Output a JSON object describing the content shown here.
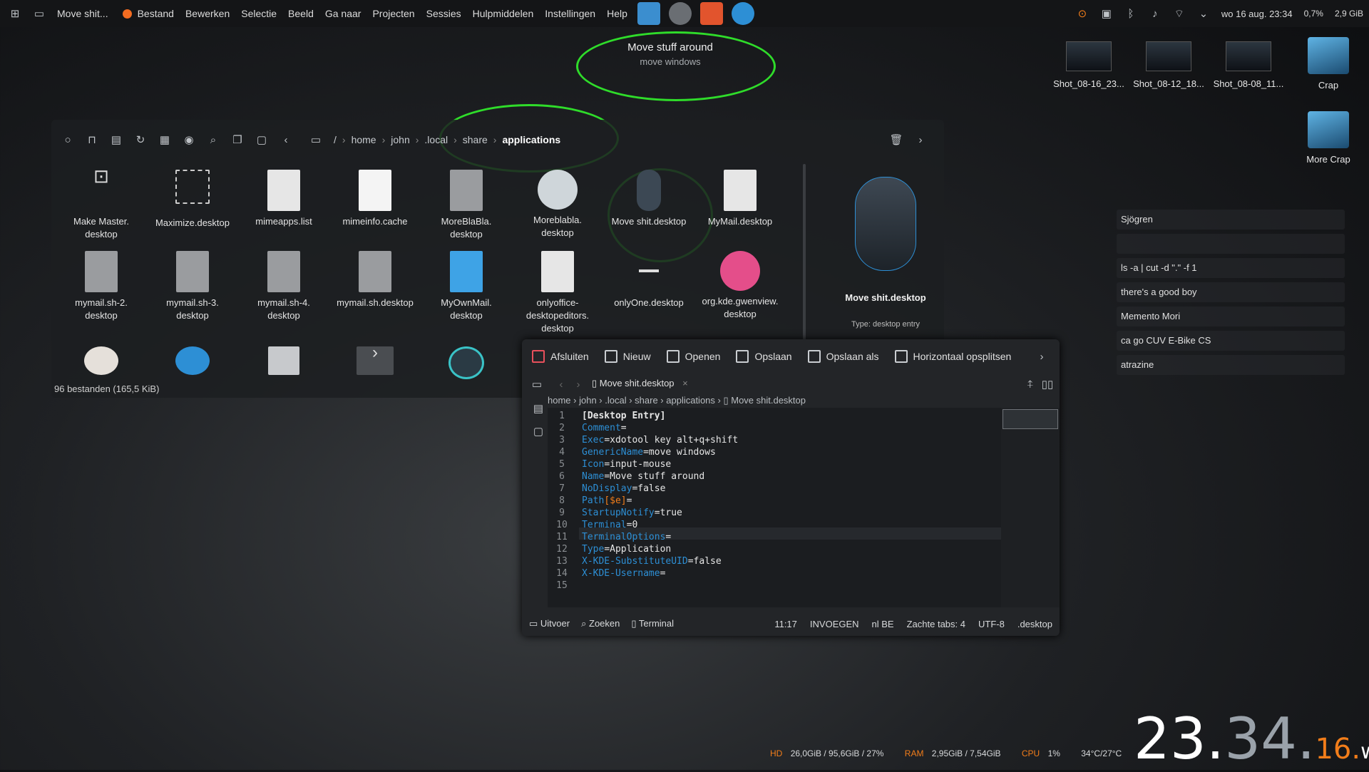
{
  "panel": {
    "app_title": "Move shit...",
    "menu": [
      "Bestand",
      "Bewerken",
      "Selectie",
      "Beeld",
      "Ga naar",
      "Projecten",
      "Sessies",
      "Hulpmiddelen",
      "Instellingen",
      "Help"
    ],
    "datetime": "wo 16 aug. 23:34",
    "cpu_pct": "0,7%",
    "ram": "2,9 GiB"
  },
  "tooltip": {
    "title": "Move stuff around",
    "subtitle": "move windows"
  },
  "desktop_icons": [
    "Shot_08-16_23...",
    "Shot_08-12_18...",
    "Shot_08-08_11...",
    "Crap",
    "More Crap"
  ],
  "dolphin": {
    "breadcrumb": [
      "/",
      "home",
      "john",
      ".local",
      "share",
      "applications"
    ],
    "files": [
      [
        "Make Master.",
        "desktop"
      ],
      [
        "Maximize.desktop",
        ""
      ],
      [
        "mimeapps.list",
        ""
      ],
      [
        "mimeinfo.cache",
        ""
      ],
      [
        "MoreBlaBla.",
        "desktop"
      ],
      [
        "Moreblabla.",
        "desktop"
      ],
      [
        "Move shit.desktop",
        ""
      ],
      [
        "MyMail.desktop",
        ""
      ],
      [
        "mymail.sh-2.",
        "desktop"
      ],
      [
        "mymail.sh-3.",
        "desktop"
      ],
      [
        "mymail.sh-4.",
        "desktop"
      ],
      [
        "mymail.sh.desktop",
        ""
      ],
      [
        "MyOwnMail.",
        "desktop"
      ],
      [
        "onlyoffice-",
        "desktopeditors.",
        "desktop"
      ],
      [
        "onlyOne.desktop",
        ""
      ],
      [
        "org.kde.gwenview.",
        "desktop"
      ]
    ],
    "status": "96 bestanden (165,5 KiB)",
    "preview_name": "Move shit.desktop",
    "preview_type_label": "Type:",
    "preview_type_value": "desktop entry"
  },
  "kate": {
    "toolbar": [
      "Afsluiten",
      "Nieuw",
      "Openen",
      "Opslaan",
      "Opslaan als",
      "Horizontaal opsplitsen"
    ],
    "tab": "Move shit.desktop",
    "breadcrumb": [
      "home",
      "john",
      ".local",
      "share",
      "applications",
      "Move shit.desktop"
    ],
    "lines": [
      {
        "n": "1",
        "k": "[Desktop Entry]",
        "v": ""
      },
      {
        "n": "2",
        "k": "Comment",
        "v": "="
      },
      {
        "n": "3",
        "k": "Exec",
        "v": "=xdotool key alt+q+shift"
      },
      {
        "n": "4",
        "k": "GenericName",
        "v": "=move windows"
      },
      {
        "n": "5",
        "k": "Icon",
        "v": "=input-mouse"
      },
      {
        "n": "6",
        "k": "Name",
        "v": "=Move stuff around"
      },
      {
        "n": "7",
        "k": "NoDisplay",
        "v": "=false"
      },
      {
        "n": "8",
        "k": "Path",
        "v": "="
      },
      {
        "n": "9",
        "k": "StartupNotify",
        "v": "=true"
      },
      {
        "n": "10",
        "k": "Terminal",
        "v": "=0"
      },
      {
        "n": "11",
        "k": "TerminalOptions",
        "v": "="
      },
      {
        "n": "12",
        "k": "Type",
        "v": "=Application"
      },
      {
        "n": "13",
        "k": "X-KDE-SubstituteUID",
        "v": "=false"
      },
      {
        "n": "14",
        "k": "X-KDE-Username",
        "v": "="
      },
      {
        "n": "15",
        "k": "",
        "v": ""
      }
    ],
    "path_suffix": "[$e]",
    "status": {
      "output": "Uitvoer",
      "search": "Zoeken",
      "terminal": "Terminal",
      "pos": "11:17",
      "mode": "INVOEGEN",
      "lang": "nl BE",
      "tabs": "Zachte tabs: 4",
      "enc": "UTF-8",
      "type": ".desktop"
    }
  },
  "clipboard": [
    "Sjögren",
    "",
    "ls -a | cut -d \".\" -f 1",
    "there's a good boy",
    "Memento Mori",
    "ca go CUV E-Bike CS",
    "atrazine"
  ],
  "stats": {
    "hd_label": "HD",
    "hd_value": "26,0GiB / 95,6GiB / 27%",
    "ram_label": "RAM",
    "ram_value": "2,95GiB / 7,54GiB",
    "cpu_label": "CPU",
    "cpu_value": "1%",
    "temp": "34°C/27°C"
  },
  "clock": {
    "h": "23.",
    "m": "34.",
    "s": "16.",
    "d": "wo"
  },
  "colors": {
    "accent_green": "#2fdc2a",
    "key_blue": "#2d8fd5",
    "orange": "#f27d1a"
  }
}
